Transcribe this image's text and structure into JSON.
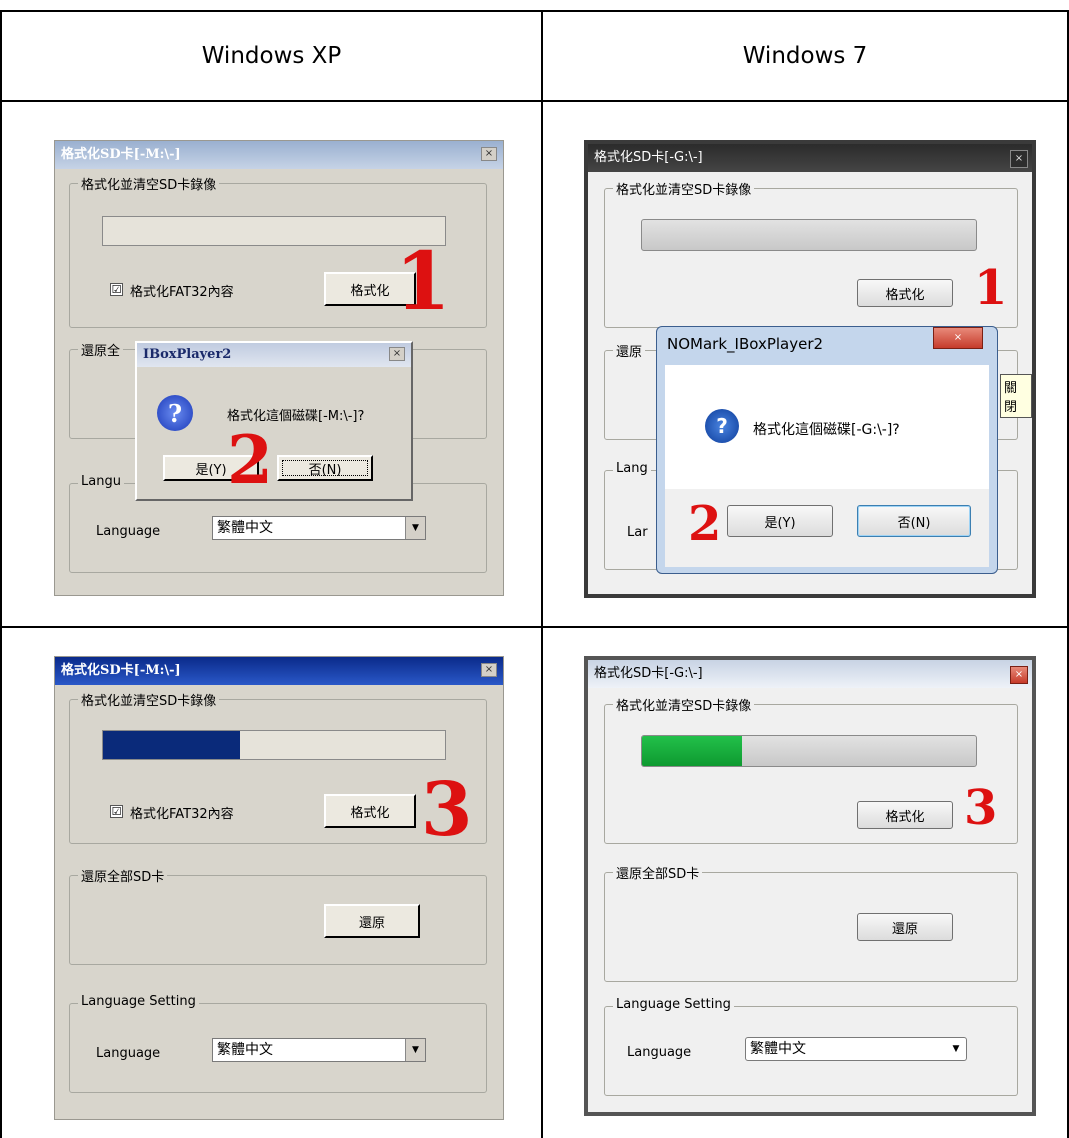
{
  "headers": {
    "xp": "Windows XP",
    "w7": "Windows 7"
  },
  "common": {
    "group_format": "格式化並清空SD卡錄像",
    "checkbox_label": "格式化FAT32內容",
    "checkbox_mark": "☑",
    "format_button": "格式化",
    "group_restore": "還原全部SD卡",
    "restore_button": "還原",
    "group_language": "Language Setting",
    "language_label": "Language",
    "language_value": "繁體中文",
    "dropdown_arrow": "▼",
    "close_glyph": "×",
    "question_glyph": "?"
  },
  "xp_title": "格式化SD卡[-M:\\-]",
  "w7_title": "格式化SD卡[-G:\\-]",
  "xp_dialog": {
    "title": "IBoxPlayer2",
    "message": "格式化這個磁碟[-M:\\-]?",
    "yes": "是(Y)",
    "no": "否(N)",
    "group_restore_partial": "還原全",
    "group_language_partial": "Langu"
  },
  "w7_dialog": {
    "title": "NOMark_IBoxPlayer2",
    "message": "格式化這個磁碟[-G:\\-]?",
    "yes": "是(Y)",
    "no": "否(N)",
    "tooltip": "關閉",
    "group_restore_partial": "還原",
    "group_language_partial": "Lang",
    "language_label_partial": "Lar"
  },
  "steps": {
    "one": "1",
    "two": "2",
    "three": "3"
  },
  "progress": {
    "xp_fraction": 0.4,
    "w7_fraction": 0.3
  },
  "colors": {
    "step": "#dd1111",
    "xp_progress": "#0a2a7a",
    "w7_progress": "#22c04a"
  }
}
